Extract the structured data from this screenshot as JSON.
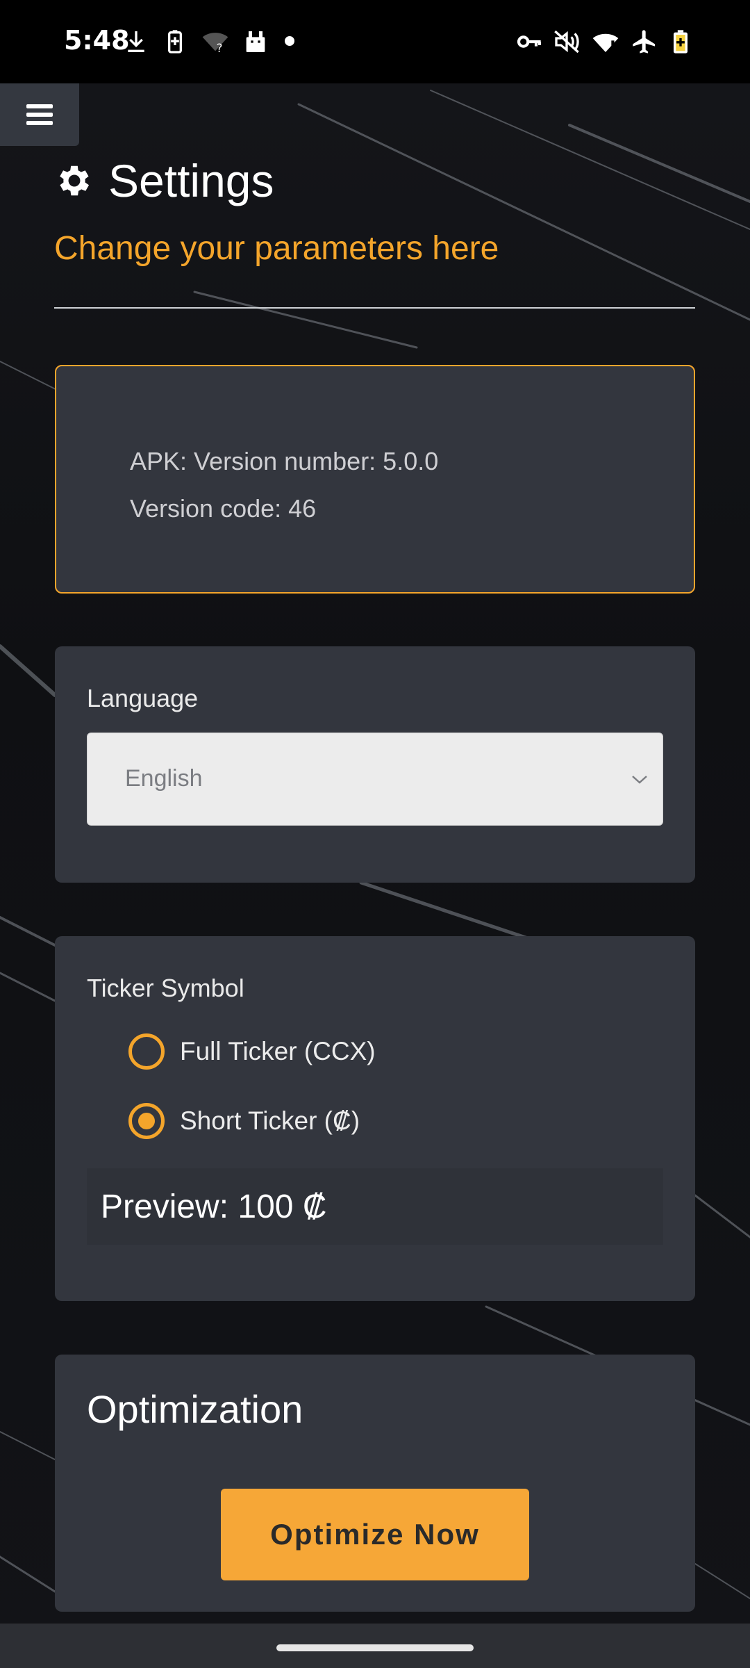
{
  "status_bar": {
    "time": "5:48",
    "icons_left": [
      "download-icon",
      "battery-saver-icon",
      "wifi-unknown-icon",
      "android-icon",
      "dot-icon"
    ],
    "icons_right": [
      "vpn-key-icon",
      "mute-icon",
      "wifi-alert-icon",
      "airplane-icon",
      "battery-icon"
    ]
  },
  "header": {
    "title": "Settings",
    "subtitle": "Change your parameters here"
  },
  "version_card": {
    "version_line": "APK: Version number: 5.0.0",
    "code_line": "Version code: 46"
  },
  "language": {
    "label": "Language",
    "selected": "English"
  },
  "ticker": {
    "label": "Ticker Symbol",
    "options": [
      {
        "label": "Full Ticker (CCX)",
        "checked": false
      },
      {
        "label": "Short Ticker (₡)",
        "checked": true
      }
    ],
    "preview": "Preview: 100 ₡"
  },
  "optimization": {
    "title": "Optimization",
    "button_label": "Optimize Now"
  },
  "colors": {
    "accent": "#f4a52b",
    "card": "#33363e",
    "background": "#0e0f12"
  }
}
